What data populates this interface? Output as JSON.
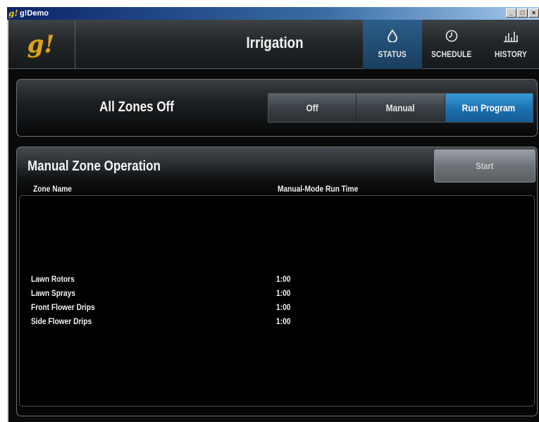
{
  "window": {
    "title": "g!Demo",
    "app_icon": "g!",
    "minimize": "_",
    "maximize": "□",
    "close": "×"
  },
  "header": {
    "logo": "g!",
    "title": "Irrigation",
    "nav": [
      {
        "label": "STATUS",
        "icon": "drop-icon",
        "glyph": "💧",
        "active": true
      },
      {
        "label": "SCHEDULE",
        "icon": "clock-icon",
        "glyph": "◷",
        "active": false
      },
      {
        "label": "HISTORY",
        "icon": "bar-chart-icon",
        "glyph": "ılıl",
        "active": false
      }
    ]
  },
  "mode": {
    "status_text": "All Zones Off",
    "options": [
      {
        "label": "Off",
        "active": false
      },
      {
        "label": "Manual",
        "active": false
      },
      {
        "label": "Run Program",
        "active": true
      }
    ]
  },
  "manual": {
    "title": "Manual Zone Operation",
    "start_label": "Start",
    "col_zone": "Zone Name",
    "col_time": "Manual-Mode Run Time",
    "zones": [
      {
        "name": "Lawn Rotors",
        "time": "1:00"
      },
      {
        "name": "Lawn Sprays",
        "time": "1:00"
      },
      {
        "name": "Front Flower Drips",
        "time": "1:00"
      },
      {
        "name": "Side Flower Drips",
        "time": "1:00"
      }
    ]
  },
  "colors": {
    "accent": "#1c6fb0",
    "logo": "#d9a21c",
    "background": "#0a0a0a"
  }
}
